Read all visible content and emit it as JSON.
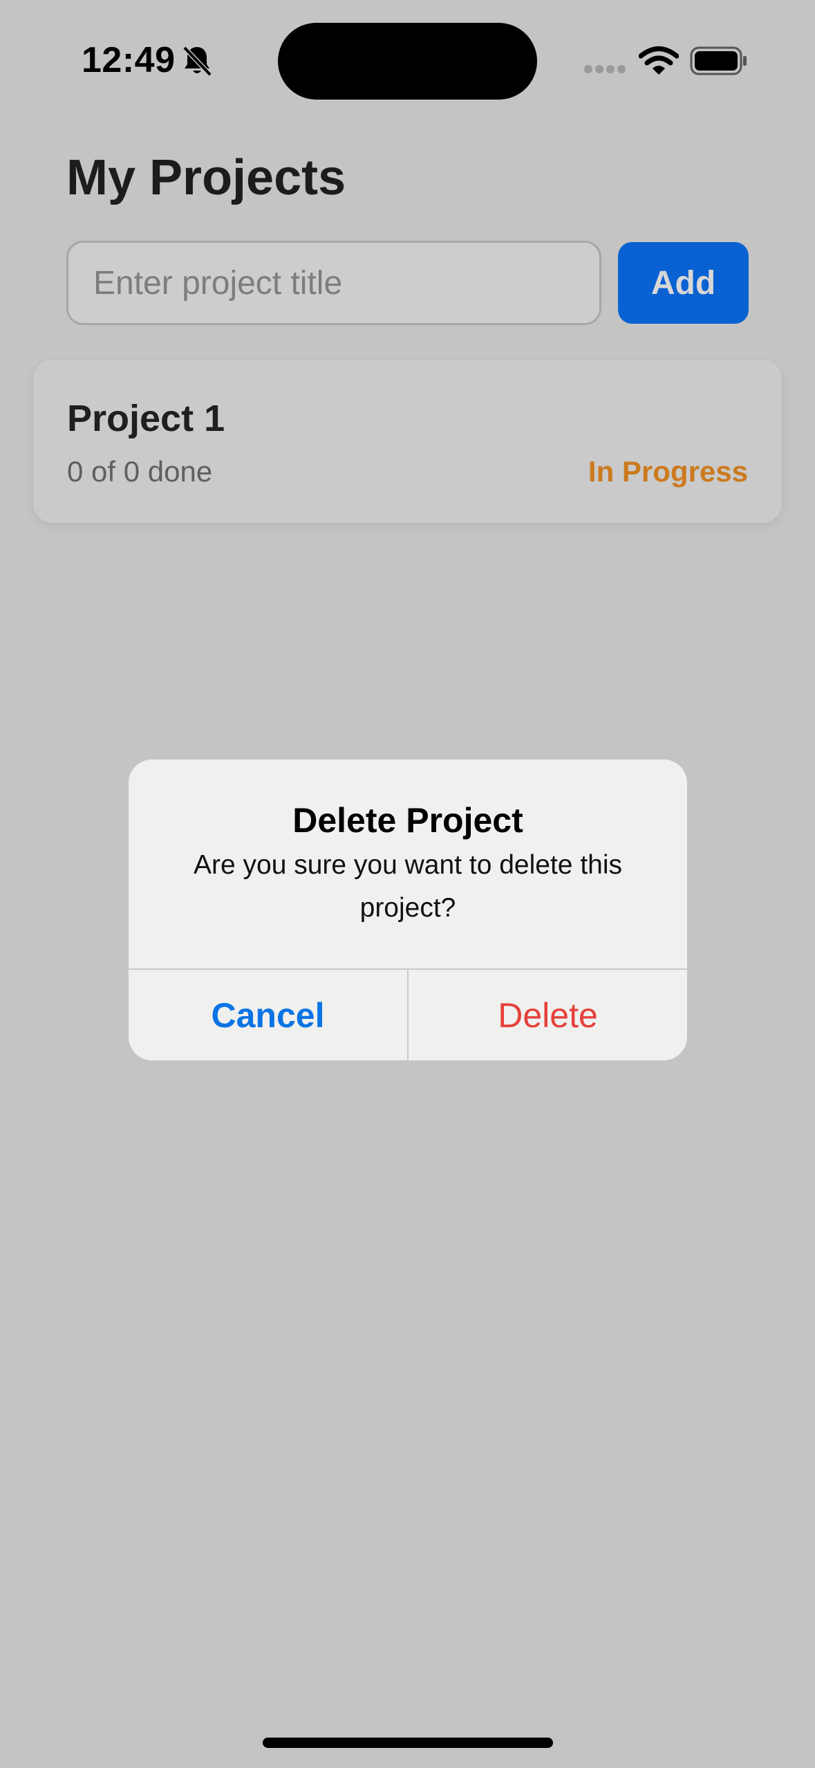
{
  "status_bar": {
    "time": "12:49",
    "icons": [
      "bell-slash-icon",
      "signal-icon",
      "wifi-icon",
      "battery-icon"
    ]
  },
  "header": {
    "title": "My Projects"
  },
  "new_project": {
    "placeholder": "Enter project title",
    "value": "",
    "add_label": "Add"
  },
  "projects": [
    {
      "name": "Project 1",
      "progress": "0 of 0 done",
      "status": "In Progress"
    }
  ],
  "alert": {
    "title": "Delete Project",
    "message": "Are you sure you want to delete this project?",
    "cancel_label": "Cancel",
    "delete_label": "Delete"
  },
  "colors": {
    "background_dimmed": "#c4c4c4",
    "add_button": "#0a62d2",
    "status_in_progress": "#cc7a1e",
    "alert_cancel": "#0b74e4",
    "alert_delete": "#e5403a"
  }
}
